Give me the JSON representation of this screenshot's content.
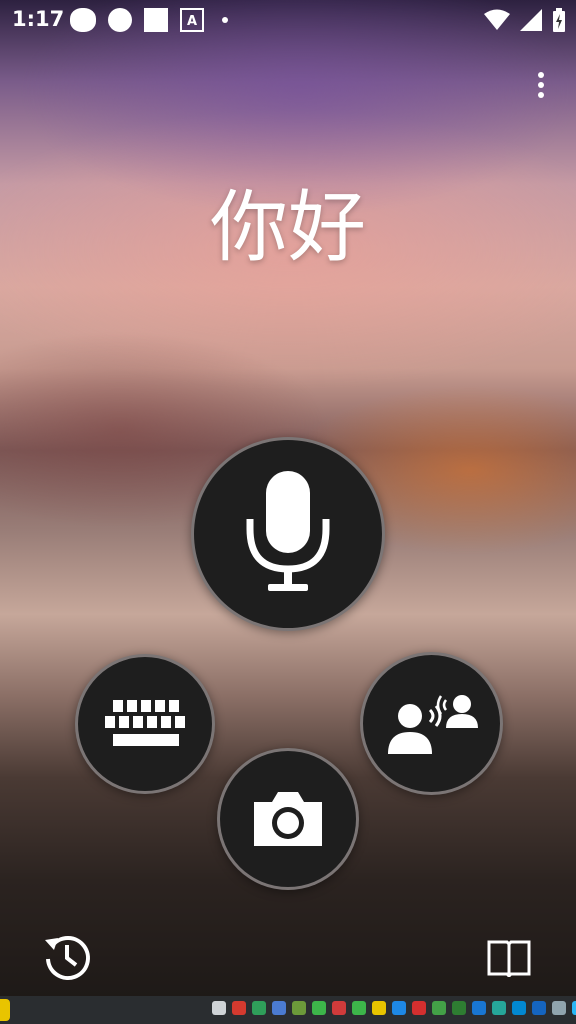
{
  "status_bar": {
    "time": "1:17",
    "notification_icons": [
      "owl-icon",
      "circle-icon",
      "square-icon",
      "translate-a-icon",
      "dot-icon"
    ],
    "system_icons": [
      "wifi-icon",
      "cell-signal-icon",
      "battery-icon"
    ]
  },
  "app": {
    "greeting": "你好",
    "menu_icon": "more-vert-icon"
  },
  "actions": {
    "voice": "mic-icon",
    "keyboard": "keyboard-icon",
    "camera": "camera-icon",
    "conversation": "conversation-icon",
    "history": "history-icon",
    "phrasebook": "phrasebook-icon"
  },
  "taskbar": {
    "tray_icons": [
      "window-icon",
      "z-icon",
      "green-icon",
      "cloud-icon",
      "chat-icon",
      "wechat-icon",
      "red-icon",
      "wechat-icon-2",
      "yellow-icon",
      "flag-icon",
      "red-v-icon",
      "wechat-icon-3",
      "green-icon-2",
      "blue-icon",
      "update-icon",
      "network-icon",
      "bluetooth-icon",
      "notes-icon",
      "checkbox-icon"
    ],
    "colors": [
      "#cfd3d6",
      "#d43a2f",
      "#2f9e5a",
      "#4b7bd1",
      "#6c9a3a",
      "#3db54a",
      "#d03b3b",
      "#3db54a",
      "#e8c400",
      "#1e88e5",
      "#d32f2f",
      "#43a047",
      "#2e7d32",
      "#1976d2",
      "#26a69a",
      "#0288d1",
      "#1565c0",
      "#90a4ae",
      "#29b6f6"
    ]
  }
}
